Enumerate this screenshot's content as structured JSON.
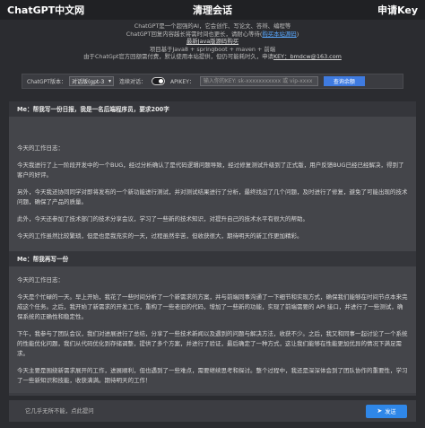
{
  "header": {
    "brand": "ChatGPT中文网",
    "title": "清理会话",
    "apply_key": "申请Key"
  },
  "notice": {
    "line1": "ChatGPT是一个超强的AI，它会创作、写论文、答辩、编程等",
    "line2a": "ChatGPT回复内容越长将需时间也更长，请耐心等待(",
    "line2_link": "购买本站源码",
    "line2b": ")",
    "line3_link": "最新Java版源码购买",
    "line4": "项目基于Java8 + springboot + maven + 前端",
    "line5a": "由于ChatGpt官方回额需付费，默认使用本站提供，但仍可能耗时久，申请",
    "line5_link": "KEY：bmdcw@163.com"
  },
  "config": {
    "version_label": "ChatGPT版本：",
    "version_value": "对话版(gpt-3",
    "context_label": "连续对话：",
    "apikey_label": "APIKEY：",
    "apikey_placeholder": "输入你的KEY: sk-xxxxxxxxxxx 或 vip-xxxx",
    "balance_button": "查询余额"
  },
  "messages": [
    {
      "question": "Me：帮我写一份日报，我是一名后端程序员，要求200字",
      "answer": [
        "今天的工作日志：",
        "今天我进行了上一阶段开发中的一个BUG，经过分析确认了是代码逻辑问题导致，经过修复测试升级到了正式版，用户反馈BUG已经已经解决，得到了客户的好评。",
        "另外，今天我还协同同学对即将发布的一个新功能进行测试，并对测试结果进行了分析，最终找出了几个问题，及时进行了修复，避免了可能出现的技术问题，确保了产品的质量。",
        "此外，今天还参加了技术部门的技术分享会议，学习了一些新的技术知识，对提升自己的技术水平有很大的帮助。",
        "今天的工作虽然比较繁琐，但是也是我充实的一天，过程虽然辛苦，但收获很大，期待明天的新工作更加精彩。"
      ]
    },
    {
      "question": "Me：帮我再写一份",
      "answer": [
        "今天的工作日志：",
        "今天是个忙碌的一天。早上开始，我花了一些时间分析了一个新需求的方案，并与前端同事沟通了一下细节和实现方式，确保我们能够在时间节点本来完成这个任务。之后，我开始了新需求的开发工作，重构了一些老旧的代码，增加了一些新的功能，实现了前端需要的 API 接口，并进行了一些测试，确保系统的正确性和稳定性。",
        "下午，我参与了团队会议，我们对进展进行了总结，分享了一些技术新闻以及遇到的问题与解决方法，收获不少。之后，我又和同事一起讨论了一个系统的性能优化问题，我们从代码优化到存储调整，提供了多个方案，并进行了验证，最后确定了一种方式，这让我们能够在性能更加优异的情况下满足需求。",
        "今天主要是围绕新需求展开的工作，进展顺利，但也遇到了一些难点，需要继续思考和探讨。整个过程中，我还是深深体会到了团队协作的重要性，学习了一些新知识和技能，收获满满。期待明天的工作！"
      ]
    }
  ],
  "footer": {
    "input_placeholder": "它几乎无所不能，点此提问",
    "send_label": "发送"
  }
}
